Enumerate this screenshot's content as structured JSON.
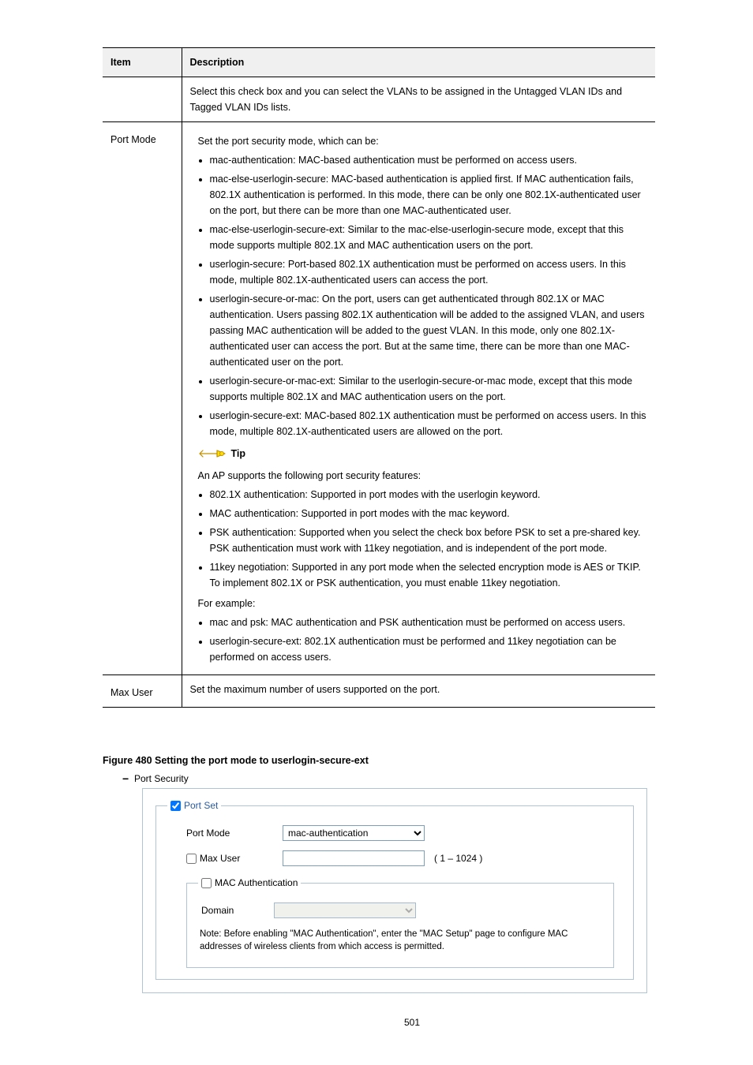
{
  "table": {
    "headers": {
      "item": "Item",
      "description": "Description"
    },
    "row0": {
      "item": "",
      "description": "Select this check box and you can select the VLANs to be assigned in the Untagged VLAN IDs and Tagged VLAN IDs lists."
    },
    "row1": {
      "item": "Port Mode",
      "intro": "Set the port security mode, which can be:",
      "bullets": {
        "b0": "mac-authentication: MAC-based authentication must be performed on access users.",
        "b1": "mac-else-userlogin-secure: MAC-based authentication is applied first. If MAC authentication fails, 802.1X authentication is performed. In this mode, there can be only one 802.1X-authenticated user on the port, but there can be more than one MAC-authenticated user.",
        "b2": "mac-else-userlogin-secure-ext: Similar to the mac-else-userlogin-secure mode, except that this mode supports multiple 802.1X and MAC authentication users on the port.",
        "b3": "userlogin-secure: Port-based 802.1X authentication must be performed on access users. In this mode, multiple 802.1X-authenticated users can access the port.",
        "b4": "userlogin-secure-or-mac: On the port, users can get authenticated through 802.1X or MAC authentication. Users passing 802.1X authentication will be added to the assigned VLAN, and users passing MAC authentication will be added to the guest VLAN. In this mode, only one 802.1X-authenticated user can access the port. But at the same time, there can be more than one MAC-authenticated user on the port.",
        "b5": "userlogin-secure-or-mac-ext: Similar to the userlogin-secure-or-mac mode, except that this mode supports multiple 802.1X and MAC authentication users on the port.",
        "b6": "userlogin-secure-ext: MAC-based 802.1X authentication must be performed on access users. In this mode, multiple 802.1X-authenticated users are allowed on the port."
      },
      "tip_label": "Tip",
      "tip_intro": "An AP supports the following port security features:",
      "tip_bullets": {
        "t0": "802.1X authentication: Supported in port modes with the userlogin keyword.",
        "t1": "MAC authentication: Supported in port modes with the mac keyword.",
        "t2": "PSK authentication: Supported when you select the check box before PSK to set a pre-shared key. PSK authentication must work with 11key negotiation, and is independent of the port mode.",
        "t3": "11key negotiation: Supported in any port mode when the selected encryption mode is AES or TKIP. To implement 802.1X or PSK authentication, you must enable 11key negotiation.",
        "eg_intro": "For example:",
        "e0": "mac and psk: MAC authentication and PSK authentication must be performed on access users.",
        "e1": "userlogin-secure-ext: 802.1X authentication must be performed and 11key negotiation can be performed on access users."
      }
    },
    "row2": {
      "item": "Max User",
      "description": "Set the maximum number of users supported on the port."
    }
  },
  "figure_caption": "Figure 480 Setting the port mode to userlogin-secure-ext",
  "screenshot": {
    "section_title": "Port Security",
    "portset": {
      "legend": "Port Set",
      "portmode_label": "Port Mode",
      "portmode_value": "mac-authentication",
      "maxuser_label": "Max User",
      "maxuser_value": "",
      "maxuser_range": "( 1 – 1024 )"
    },
    "macauth": {
      "legend": "MAC Authentication",
      "domain_label": "Domain",
      "domain_value": "",
      "note": "Note: Before enabling \"MAC Authentication\", enter the \"MAC Setup\" page to configure MAC addresses of wireless clients from which access is permitted."
    }
  },
  "page_number": "501"
}
